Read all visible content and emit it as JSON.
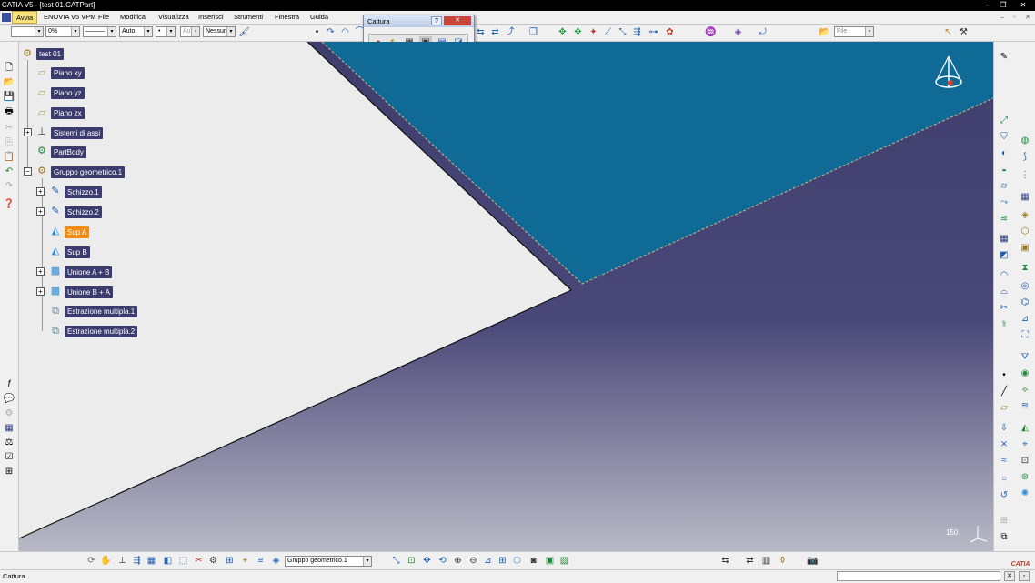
{
  "window": {
    "title": "CATIA V5 - [test 01.CATPart]",
    "buttons": [
      "–",
      "❐",
      "✕"
    ],
    "doc_buttons": [
      "–",
      "▫",
      "✕"
    ]
  },
  "menu": {
    "items": [
      "Avvia",
      "ENOVIA V5 VPM",
      "File",
      "Modifica",
      "Visualizza",
      "Inserisci",
      "Strumenti",
      "Finestra",
      "Guida"
    ],
    "active": "Avvia"
  },
  "toolbar": {
    "line_color": "",
    "transparency": "0%",
    "line_type": "———",
    "line_weight": "Auto",
    "point_style": "•",
    "layer_short": "Aut",
    "layer": "Nessuno",
    "file_field": "File"
  },
  "capture_window": {
    "title": "Cattura",
    "help": "?",
    "close": "✕"
  },
  "tree": {
    "root": "test 01",
    "items": [
      {
        "label": "Piano xy",
        "icon": "plane-icon",
        "level": 1,
        "expand": false
      },
      {
        "label": "Piano yz",
        "icon": "plane-icon",
        "level": 1,
        "expand": false
      },
      {
        "label": "Piano zx",
        "icon": "plane-icon",
        "level": 1,
        "expand": false
      },
      {
        "label": "Sistemi di assi",
        "icon": "axis-system-icon",
        "level": 1,
        "expand": true
      },
      {
        "label": "PartBody",
        "icon": "gear-body-icon",
        "level": 1,
        "expand": false
      },
      {
        "label": "Gruppo geometrico.1",
        "icon": "geometric-set-icon",
        "level": 1,
        "expand": "open"
      },
      {
        "label": "Schizzo.1",
        "icon": "sketch-icon",
        "level": 2,
        "expand": true
      },
      {
        "label": "Schizzo.2",
        "icon": "sketch-icon",
        "level": 2,
        "expand": true
      },
      {
        "label": "Sup A",
        "icon": "surface-icon",
        "level": 2,
        "expand": false,
        "selected": true
      },
      {
        "label": "Sup B",
        "icon": "surface-icon",
        "level": 2,
        "expand": false
      },
      {
        "label": "Unione A + B",
        "icon": "join-icon",
        "level": 2,
        "expand": true
      },
      {
        "label": "Unione B + A",
        "icon": "join-icon",
        "level": 2,
        "expand": true
      },
      {
        "label": "Estrazione multipla.1",
        "icon": "multi-extract-icon",
        "level": 2,
        "expand": false
      },
      {
        "label": "Estrazione multipla.2",
        "icon": "multi-extract-icon",
        "level": 2,
        "expand": false
      }
    ]
  },
  "viewport": {
    "scale_label": "150",
    "colors": {
      "light_surface": "#ececec",
      "blue_surface": "#0f6a96",
      "background_top": "#3f3d6c",
      "background_bottom": "#b9b9c6",
      "selection": "#f28c14"
    }
  },
  "bottombar": {
    "current_body": "Gruppo geometrico.1"
  },
  "statusbar": {
    "text": "Cattura"
  },
  "logo": "CATIA"
}
